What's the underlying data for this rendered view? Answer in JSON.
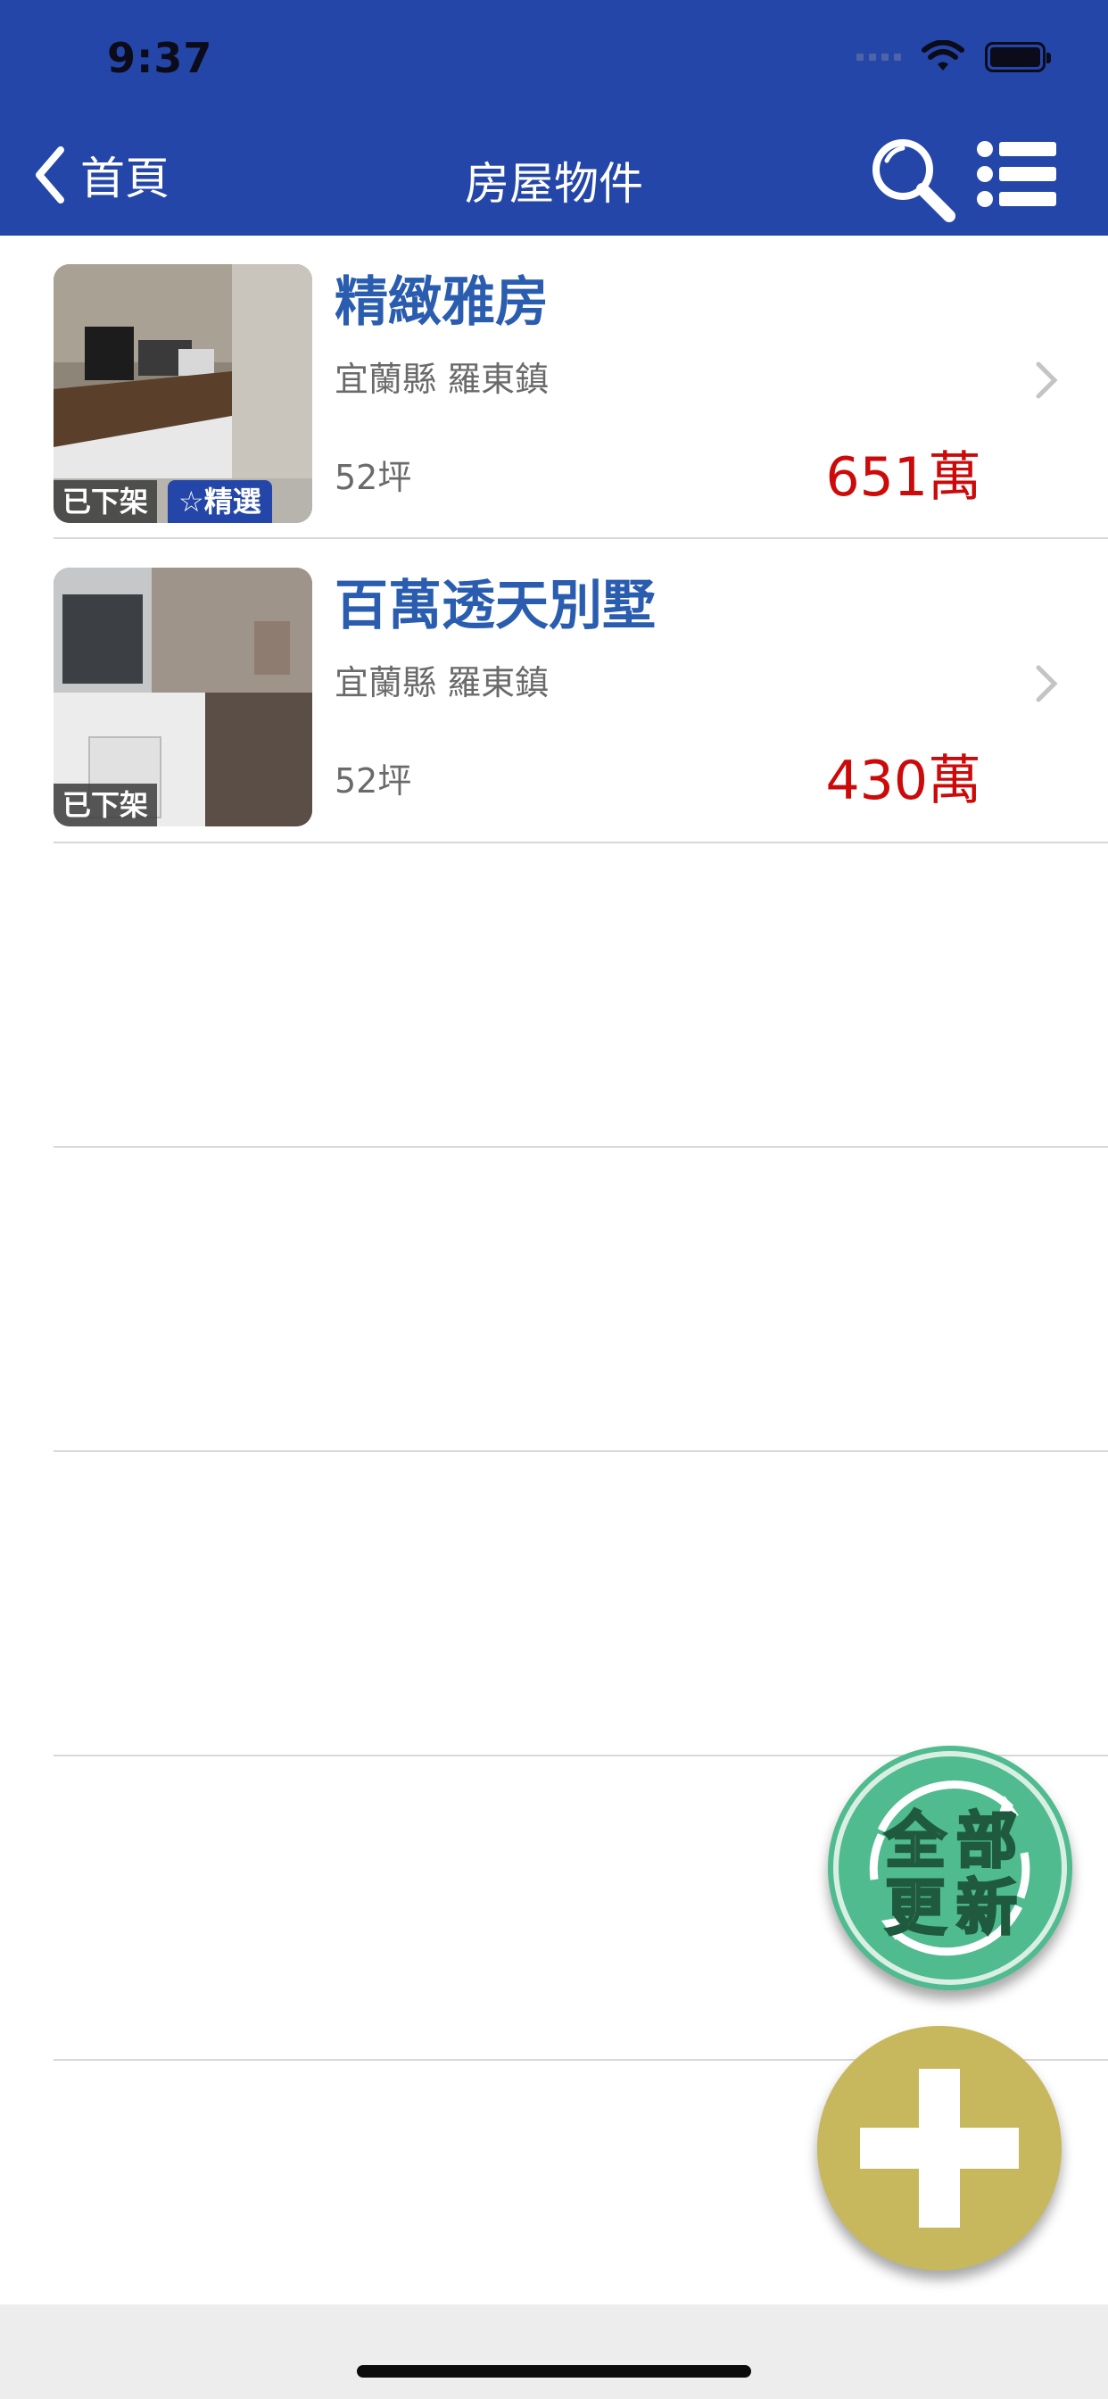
{
  "status_bar": {
    "time": "9:37"
  },
  "nav": {
    "back_label": "首頁",
    "title": "房屋物件"
  },
  "listings": [
    {
      "title": "精緻雅房",
      "location": "宜蘭縣 羅東鎮",
      "size": "52坪",
      "price": "651萬",
      "badge_status": "已下架",
      "badge_featured": "☆精選"
    },
    {
      "title": "百萬透天別墅",
      "location": "宜蘭縣 羅東鎮",
      "size": "52坪",
      "price": "430萬",
      "badge_status": "已下架"
    }
  ],
  "fab": {
    "refresh_label_line1": "全部",
    "refresh_label_line2": "更新"
  },
  "colors": {
    "nav_bg": "#2446a8",
    "title_blue": "#2a5db0",
    "price_red": "#cc0a0a",
    "refresh_green": "#4fbb8f",
    "add_gold": "#c7b85d"
  }
}
